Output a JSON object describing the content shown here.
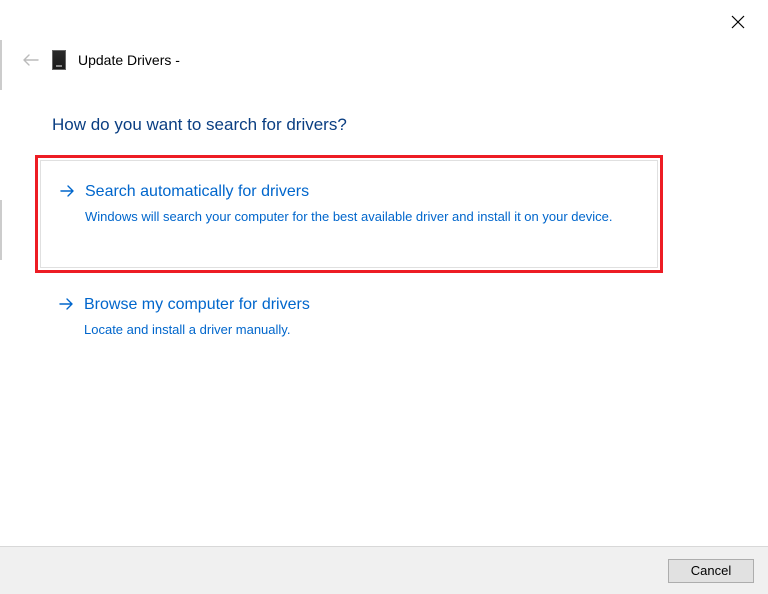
{
  "header": {
    "title": "Update Drivers -"
  },
  "heading": "How do you want to search for drivers?",
  "options": [
    {
      "title": "Search automatically for drivers",
      "description": "Windows will search your computer for the best available driver and install it on your device."
    },
    {
      "title": "Browse my computer for drivers",
      "description": "Locate and install a driver manually."
    }
  ],
  "buttons": {
    "cancel": "Cancel"
  }
}
